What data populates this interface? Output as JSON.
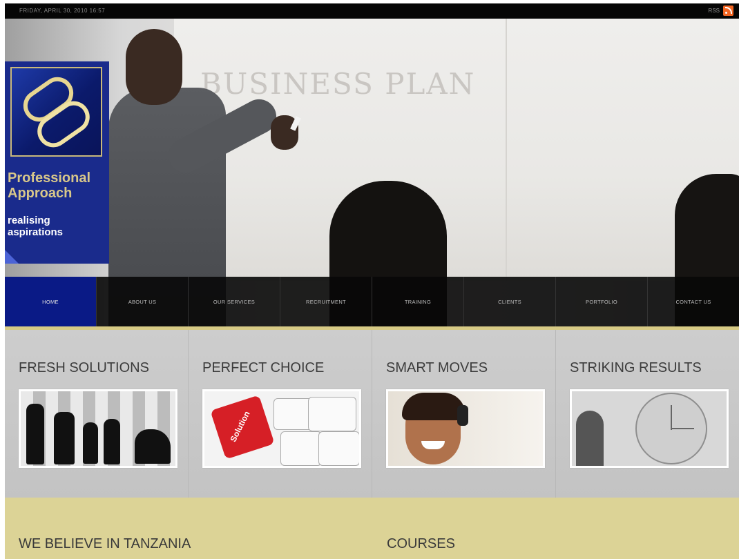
{
  "topbar": {
    "date": "FRIDAY, APRIL 30, 2010 16:57",
    "rss_label": "RSS",
    "rss_icon": "rss-icon"
  },
  "hero": {
    "whiteboard_text": "BUSINESS PLAN"
  },
  "logo": {
    "title_line1": "Professional",
    "title_line2": "Approach",
    "tagline_line1": "realising",
    "tagline_line2": "aspirations",
    "colors": {
      "background": "#1a2b8c",
      "title": "#d8c78a",
      "tagline": "#ffffff"
    }
  },
  "nav": {
    "items": [
      {
        "label": "HOME",
        "active": true
      },
      {
        "label": "ABOUT US"
      },
      {
        "label": "OUR SERVICES"
      },
      {
        "label": "RECRUITMENT"
      },
      {
        "label": "TRAINING"
      },
      {
        "label": "CLIENTS"
      },
      {
        "label": "PORTFOLIO"
      },
      {
        "label": "CONTACT US"
      }
    ],
    "active_color": "#0a1a86",
    "underline_color": "#d7ca85"
  },
  "features": [
    {
      "title": "FRESH SOLUTIONS",
      "image": "chess-pieces"
    },
    {
      "title": "PERFECT CHOICE",
      "image": "puzzle-solution",
      "image_text": "Solution"
    },
    {
      "title": "SMART MOVES",
      "image": "call-center-agent"
    },
    {
      "title": "STRIKING RESULTS",
      "image": "clock-business"
    }
  ],
  "lower": {
    "left_heading": "WE BELIEVE IN TANZANIA",
    "right_heading": "COURSES",
    "background": "#dcd396"
  }
}
